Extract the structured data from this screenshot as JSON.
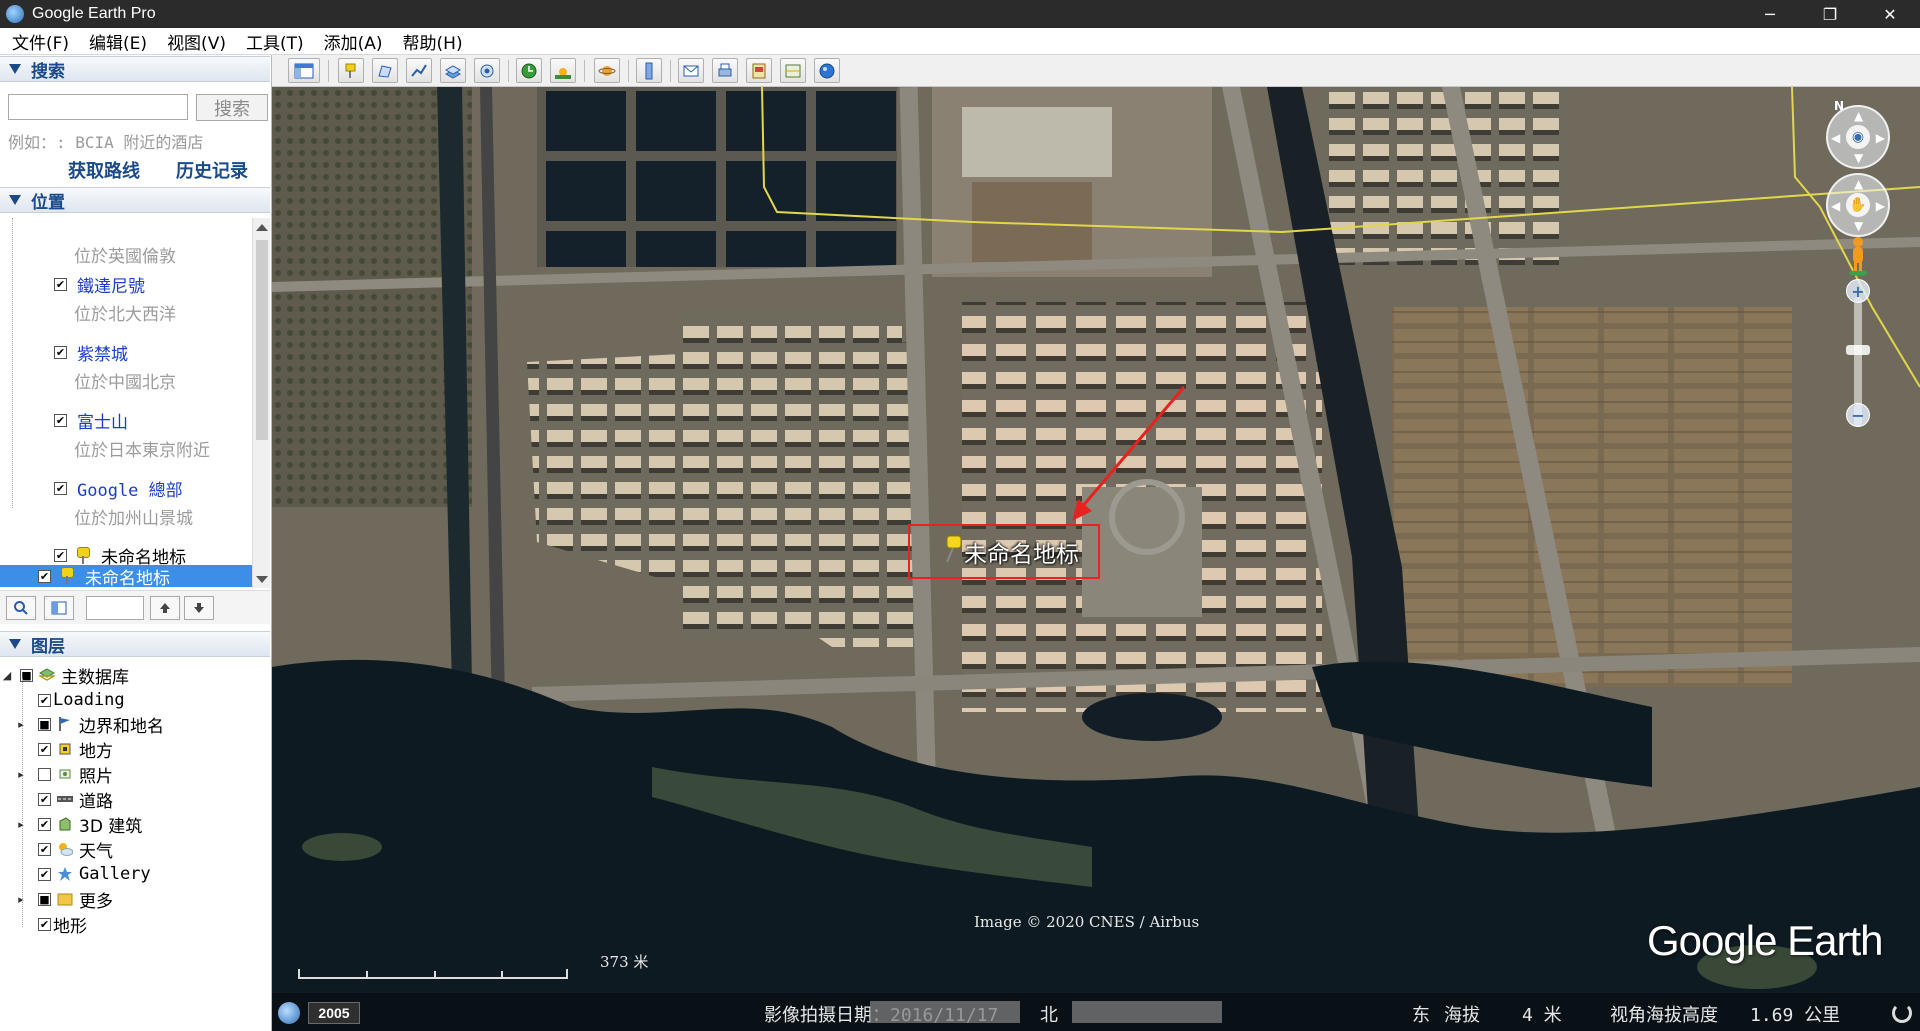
{
  "window": {
    "title": "Google Earth Pro",
    "minimize_label": "─",
    "restore_label": "❐",
    "close_label": "✕"
  },
  "menu": [
    "文件(F)",
    "编辑(E)",
    "视图(V)",
    "工具(T)",
    "添加(A)",
    "帮助(H)"
  ],
  "search": {
    "header": "搜索",
    "input_value": "",
    "button_label": "搜索",
    "hint": "例如：: BCIA 附近的酒店",
    "get_directions": "获取路线",
    "history": "历史记录"
  },
  "places": {
    "header": "位置",
    "items": [
      {
        "title": "",
        "subtitle": "位於英國倫敦"
      },
      {
        "title": "鐵達尼號",
        "subtitle": "位於北大西洋"
      },
      {
        "title": "紫禁城",
        "subtitle": "位於中國北京"
      },
      {
        "title": "富士山",
        "subtitle": "位於日本東京附近"
      },
      {
        "title": "Google 總部",
        "subtitle": "位於加州山景城"
      }
    ],
    "placemark_1": "未命名地标",
    "placemark_selected": "未命名地标"
  },
  "layers": {
    "header": "图层",
    "items": [
      {
        "label": "主数据库",
        "icon": "database-icon"
      },
      {
        "label": "Loading",
        "icon": ""
      },
      {
        "label": "边界和地名",
        "icon": "flag-icon"
      },
      {
        "label": "地方",
        "icon": "place-icon"
      },
      {
        "label": "照片",
        "icon": "photo-icon"
      },
      {
        "label": "道路",
        "icon": "road-icon"
      },
      {
        "label": "3D 建筑",
        "icon": "building-icon"
      },
      {
        "label": "天气",
        "icon": "weather-icon"
      },
      {
        "label": "Gallery",
        "icon": "star-icon"
      },
      {
        "label": "更多",
        "icon": "folder-icon"
      },
      {
        "label": "地形",
        "icon": ""
      }
    ]
  },
  "map": {
    "placemark_label": "未命名地标",
    "copyright": "Image © 2020 CNES / Airbus",
    "scale_label": "373 米",
    "logo": "Google Earth",
    "north": "N",
    "status": {
      "year": "2005",
      "imagery_date": "影像拍摄日期：2016/11/17",
      "north_coord": "北",
      "east_coord": "东",
      "elevation_label": "海拔",
      "elevation_value": "4 米",
      "eye_alt_label": "视角海拔高度",
      "eye_alt_value": "1.69 公里"
    }
  },
  "colors": {
    "accent": "#1a4a8a",
    "selection": "#3d8ee6",
    "annotation_red": "#e8221e"
  }
}
